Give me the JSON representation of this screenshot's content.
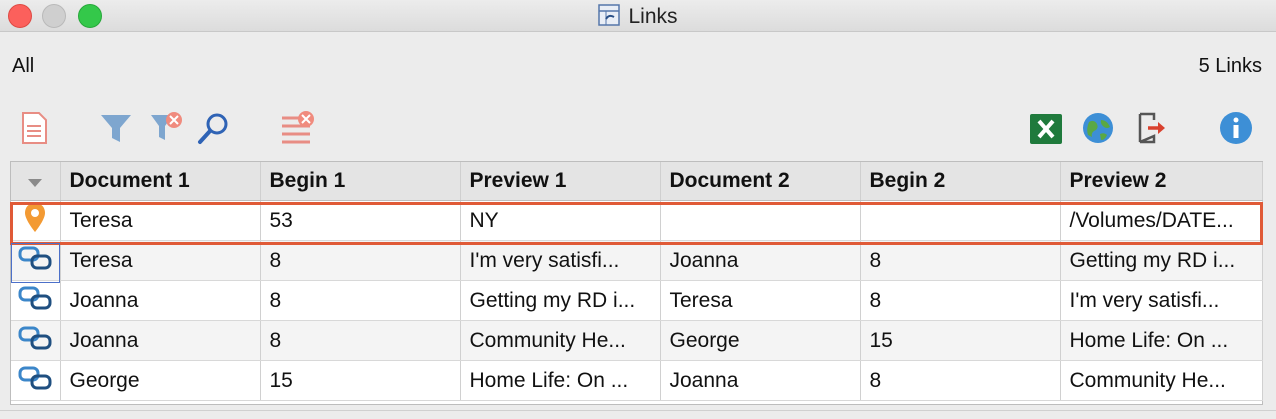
{
  "window": {
    "title": "Links"
  },
  "filter_label": "All",
  "count_label": "5 Links",
  "toolbar": {
    "left_icons": [
      "document-icon",
      "filter-icon",
      "clear-filter-icon",
      "search-icon",
      "clear-list-icon"
    ],
    "right_icons": [
      "excel-export-icon",
      "web-export-icon",
      "export-icon",
      "info-icon"
    ]
  },
  "table": {
    "columns": [
      "Document 1",
      "Begin 1",
      "Preview 1",
      "Document 2",
      "Begin 2",
      "Preview 2"
    ],
    "rows": [
      {
        "icon": "pin-icon",
        "doc1": "Teresa",
        "begin1": "53",
        "preview1": "NY",
        "doc2": "",
        "begin2": "",
        "preview2": "/Volumes/DATE..."
      },
      {
        "icon": "link-icon",
        "doc1": "Teresa",
        "begin1": "8",
        "preview1": "I'm very satisfi...",
        "doc2": "Joanna",
        "begin2": "8",
        "preview2": "Getting my RD i..."
      },
      {
        "icon": "link-icon",
        "doc1": "Joanna",
        "begin1": "8",
        "preview1": "Getting my RD i...",
        "doc2": "Teresa",
        "begin2": "8",
        "preview2": "I'm very satisfi..."
      },
      {
        "icon": "link-icon",
        "doc1": "Joanna",
        "begin1": "8",
        "preview1": "Community He...",
        "doc2": "George",
        "begin2": "15",
        "preview2": "Home Life: On ..."
      },
      {
        "icon": "link-icon",
        "doc1": "George",
        "begin1": "15",
        "preview1": "Home Life: On ...",
        "doc2": "Joanna",
        "begin2": "8",
        "preview2": "Community He..."
      }
    ]
  },
  "colors": {
    "highlight": "#e05a37",
    "excel": "#1f7a3c",
    "info": "#3d8fd6",
    "filter": "#7ea6cf",
    "pin": "#f39a33"
  }
}
